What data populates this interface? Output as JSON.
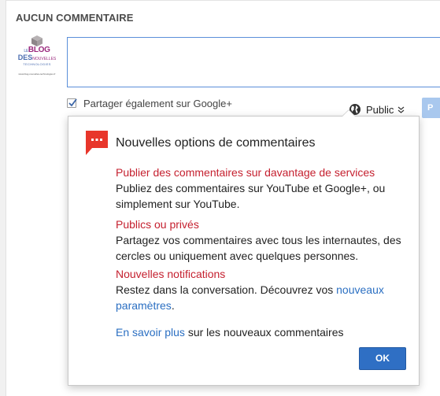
{
  "section": {
    "title": "AUCUN COMMENTAIRE"
  },
  "avatar": {
    "logo_line1_small": "LE",
    "logo_line1": "BLOG",
    "logo_line1_suffix": "DES",
    "logo_line2": "DES",
    "logo_line2_suffix": "NOUVELLES",
    "logo_line3": "TECHNOLOGIES",
    "logo_url": "www.blog-nouvelles-technologies.fr"
  },
  "comment_box": {
    "value": "",
    "placeholder": ""
  },
  "share": {
    "label": "Partager également sur Google+",
    "checked": true
  },
  "audience": {
    "label": "Public",
    "icon": "globe-icon"
  },
  "colors": {
    "accent": "#2f6fc4",
    "heading_red": "#c5202f",
    "link": "#2b6fc2",
    "icon_red": "#e8362b"
  },
  "popup": {
    "icon": "comment-bubble-icon",
    "title": "Nouvelles options de commentaires",
    "features": [
      {
        "heading": "Publier des commentaires sur davantage de services",
        "description": "Publiez des commentaires sur YouTube et Google+, ou simplement sur YouTube."
      },
      {
        "heading": "Publics ou privés",
        "description": "Partagez vos commentaires avec tous les internautes, des cercles ou uniquement avec quelques personnes."
      },
      {
        "heading": "Nouvelles notifications",
        "description": "Restez dans la conversation. Découvrez vos ",
        "link": "nouveaux paramètres",
        "suffix": "."
      }
    ],
    "learn_more": {
      "link": "En savoir plus",
      "text": " sur les nouveaux commentaires"
    },
    "ok_label": "OK"
  }
}
